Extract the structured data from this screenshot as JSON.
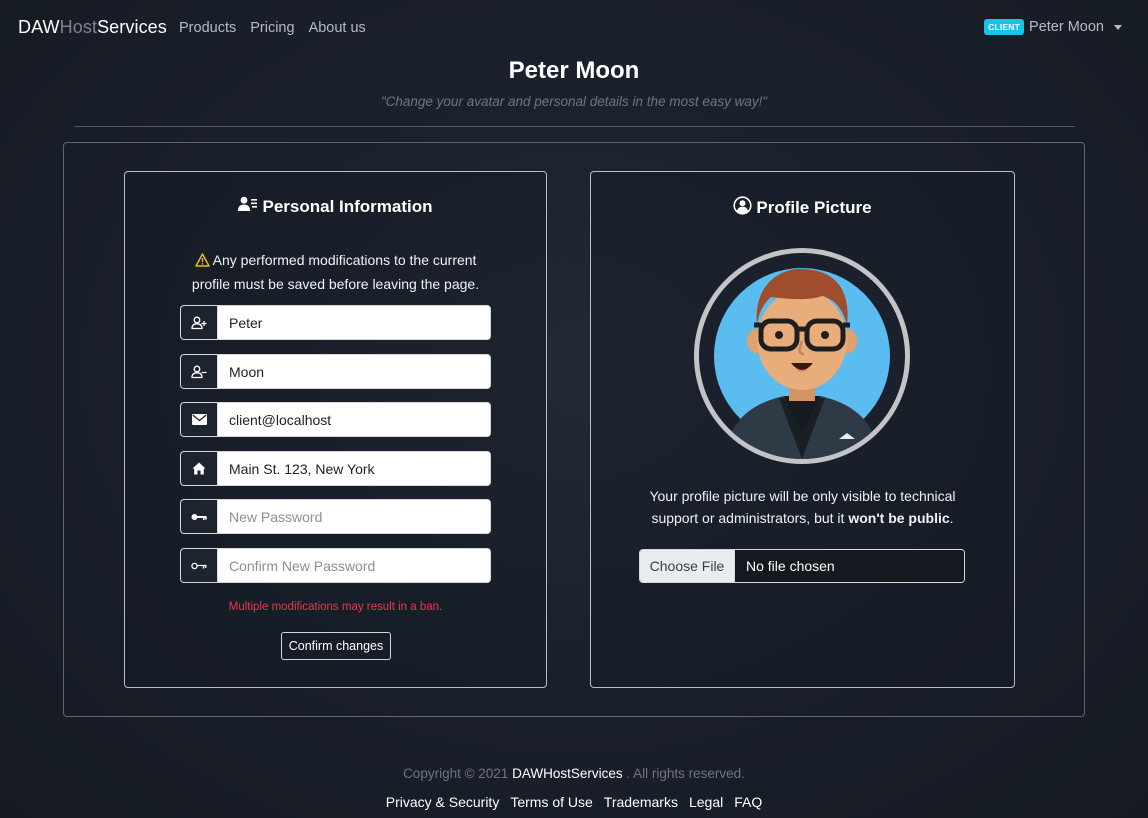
{
  "navbar": {
    "brand": {
      "part1": "DAW",
      "part2": "Host",
      "part3": "Services"
    },
    "links": [
      "Products",
      "Pricing",
      "About us"
    ],
    "user": {
      "badge": "CLIENT",
      "name": "Peter Moon"
    }
  },
  "header": {
    "title": "Peter Moon",
    "subtitle": "\"Change your avatar and personal details in the most easy way!\""
  },
  "personal": {
    "title": "Personal Information",
    "warning_line1": "Any performed modifications to the current",
    "warning_line2": "profile must be saved before leaving the page.",
    "fields": [
      {
        "icon": "user-plus-icon",
        "value": "Peter",
        "placeholder": ""
      },
      {
        "icon": "user-minus-icon",
        "value": "Moon",
        "placeholder": ""
      },
      {
        "icon": "envelope-icon",
        "value": "client@localhost",
        "placeholder": ""
      },
      {
        "icon": "house-icon",
        "value": "Main St. 123, New York",
        "placeholder": ""
      },
      {
        "icon": "key-icon",
        "value": "",
        "placeholder": "New Password"
      },
      {
        "icon": "key-outline-icon",
        "value": "",
        "placeholder": "Confirm New Password"
      }
    ],
    "ban_note": "Multiple modifications may result in a ban.",
    "confirm_label": "Confirm changes"
  },
  "picture": {
    "title": "Profile Picture",
    "note_line1": "Your profile picture will be only visible to technical",
    "note_line2_a": "support or administrators, but it ",
    "note_line2_b": "won't be public",
    "note_line2_c": ".",
    "file_button": "Choose File",
    "file_status": "No file chosen"
  },
  "footer": {
    "copyright_a": "Copyright © 2021 ",
    "copyright_brand": "DAWHostServices",
    "copyright_b": " . All rights reserved.",
    "links": [
      "Privacy & Security",
      "Terms of Use",
      "Trademarks",
      "Legal",
      "FAQ"
    ]
  },
  "colors": {
    "accent": "#19c3e6",
    "danger": "#e23b4e",
    "warning": "#f0b429"
  }
}
